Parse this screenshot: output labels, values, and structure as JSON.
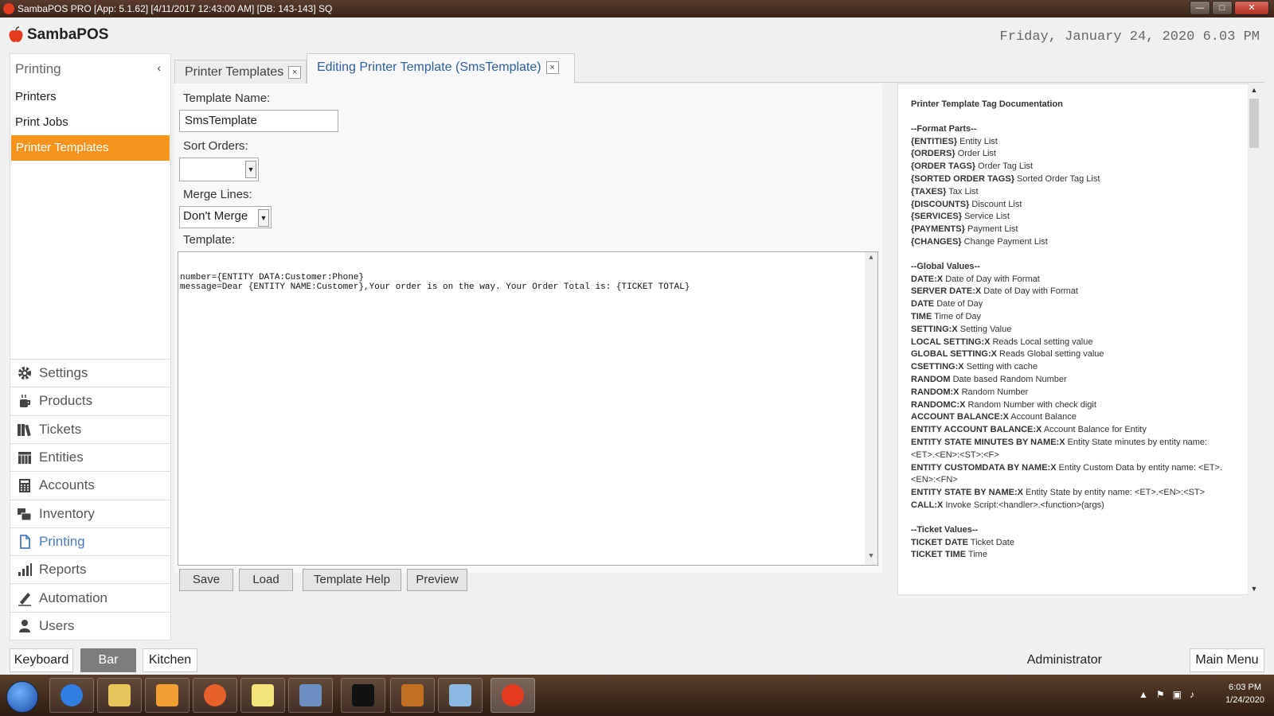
{
  "window": {
    "title": "SambaPOS PRO [App: 5.1.62] [4/11/2017 12:43:00 AM] [DB: 143-143] SQ",
    "minimize": "—",
    "maximize": "□",
    "close": "✕"
  },
  "header": {
    "logo_text": "SambaPOS",
    "datetime": "Friday, January 24, 2020 6.03 PM"
  },
  "leftnav": {
    "title": "Printing",
    "collapse_glyph": "‹",
    "items": [
      {
        "label": "Printers"
      },
      {
        "label": "Print Jobs"
      },
      {
        "label": "Printer Templates"
      }
    ],
    "menu": [
      {
        "label": "Settings",
        "icon": "gear-icon"
      },
      {
        "label": "Products",
        "icon": "coffee-icon"
      },
      {
        "label": "Tickets",
        "icon": "books-icon"
      },
      {
        "label": "Entities",
        "icon": "table-icon"
      },
      {
        "label": "Accounts",
        "icon": "calculator-icon"
      },
      {
        "label": "Inventory",
        "icon": "boxes-icon"
      },
      {
        "label": "Printing",
        "icon": "document-icon"
      },
      {
        "label": "Reports",
        "icon": "bar-chart-icon"
      },
      {
        "label": "Automation",
        "icon": "pen-icon"
      },
      {
        "label": "Users",
        "icon": "user-icon"
      }
    ]
  },
  "tabs": [
    {
      "label": "Printer Templates",
      "close": "×"
    },
    {
      "label": "Editing Printer Template (SmsTemplate)",
      "close": "×"
    }
  ],
  "form": {
    "template_name_label": "Template Name:",
    "template_name_value": "SmsTemplate",
    "sort_orders_label": "Sort Orders:",
    "sort_orders_value": "",
    "merge_lines_label": "Merge Lines:",
    "merge_lines_value": "Don't Merge",
    "template_label": "Template:",
    "template_text": "number={ENTITY DATA:Customer:Phone}\nmessage=Dear {ENTITY NAME:Customer},Your order is on the way. Your Order Total is: {TICKET TOTAL}"
  },
  "buttons": {
    "save": "Save",
    "load": "Load",
    "template_help": "Template Help",
    "preview": "Preview"
  },
  "docs": {
    "title": "Printer Template Tag Documentation",
    "sections": [
      {
        "heading": "--Format Parts--",
        "entries": [
          {
            "tag": "{ENTITIES}",
            "desc": "Entity List"
          },
          {
            "tag": "{ORDERS}",
            "desc": "Order List"
          },
          {
            "tag": "{ORDER TAGS}",
            "desc": "Order Tag List"
          },
          {
            "tag": "{SORTED ORDER TAGS}",
            "desc": "Sorted Order Tag List"
          },
          {
            "tag": "{TAXES}",
            "desc": "Tax List"
          },
          {
            "tag": "{DISCOUNTS}",
            "desc": "Discount List"
          },
          {
            "tag": "{SERVICES}",
            "desc": "Service List"
          },
          {
            "tag": "{PAYMENTS}",
            "desc": "Payment List"
          },
          {
            "tag": "{CHANGES}",
            "desc": "Change Payment List"
          }
        ]
      },
      {
        "heading": "--Global Values--",
        "entries": [
          {
            "tag": "DATE:X",
            "desc": "Date of Day with Format"
          },
          {
            "tag": "SERVER DATE:X",
            "desc": "Date of Day with Format"
          },
          {
            "tag": "DATE",
            "desc": "Date of Day"
          },
          {
            "tag": "TIME",
            "desc": "Time of Day"
          },
          {
            "tag": "SETTING:X",
            "desc": "Setting Value"
          },
          {
            "tag": "LOCAL SETTING:X",
            "desc": "Reads Local setting value"
          },
          {
            "tag": "GLOBAL SETTING:X",
            "desc": "Reads Global setting value"
          },
          {
            "tag": "CSETTING:X",
            "desc": "Setting with cache"
          },
          {
            "tag": "RANDOM",
            "desc": "Date based Random Number"
          },
          {
            "tag": "RANDOM:X",
            "desc": "Random Number"
          },
          {
            "tag": "RANDOMC:X",
            "desc": "Random Number with check digit"
          },
          {
            "tag": "ACCOUNT BALANCE:X",
            "desc": "Account Balance"
          },
          {
            "tag": "ENTITY ACCOUNT BALANCE:X",
            "desc": "Account Balance for Entity"
          },
          {
            "tag": "ENTITY STATE MINUTES BY NAME:X",
            "desc": "Entity State minutes by entity name: <ET>.<EN>:<ST>:<F>"
          },
          {
            "tag": "ENTITY CUSTOMDATA BY NAME:X",
            "desc": "Entity Custom Data by entity name: <ET>.<EN>:<FN>"
          },
          {
            "tag": "ENTITY STATE BY NAME:X",
            "desc": "Entity State by entity name: <ET>.<EN>:<ST>"
          },
          {
            "tag": "CALL:X",
            "desc": "Invoke Script:<handler>.<function>(args)"
          }
        ]
      },
      {
        "heading": "--Ticket Values--",
        "entries": [
          {
            "tag": "TICKET DATE",
            "desc": "Ticket Date"
          },
          {
            "tag": "TICKET TIME",
            "desc": "Time"
          }
        ]
      }
    ]
  },
  "bottombar": {
    "keyboard": "Keyboard",
    "bar": "Bar",
    "kitchen": "Kitchen",
    "user": "Administrator",
    "main_menu": "Main Menu"
  },
  "taskbar": {
    "time": "6:03 PM",
    "date": "1/24/2020"
  },
  "colors": {
    "accent": "#f7941d",
    "link_blue": "#2e5f9e",
    "logo_red": "#e23b1d"
  }
}
